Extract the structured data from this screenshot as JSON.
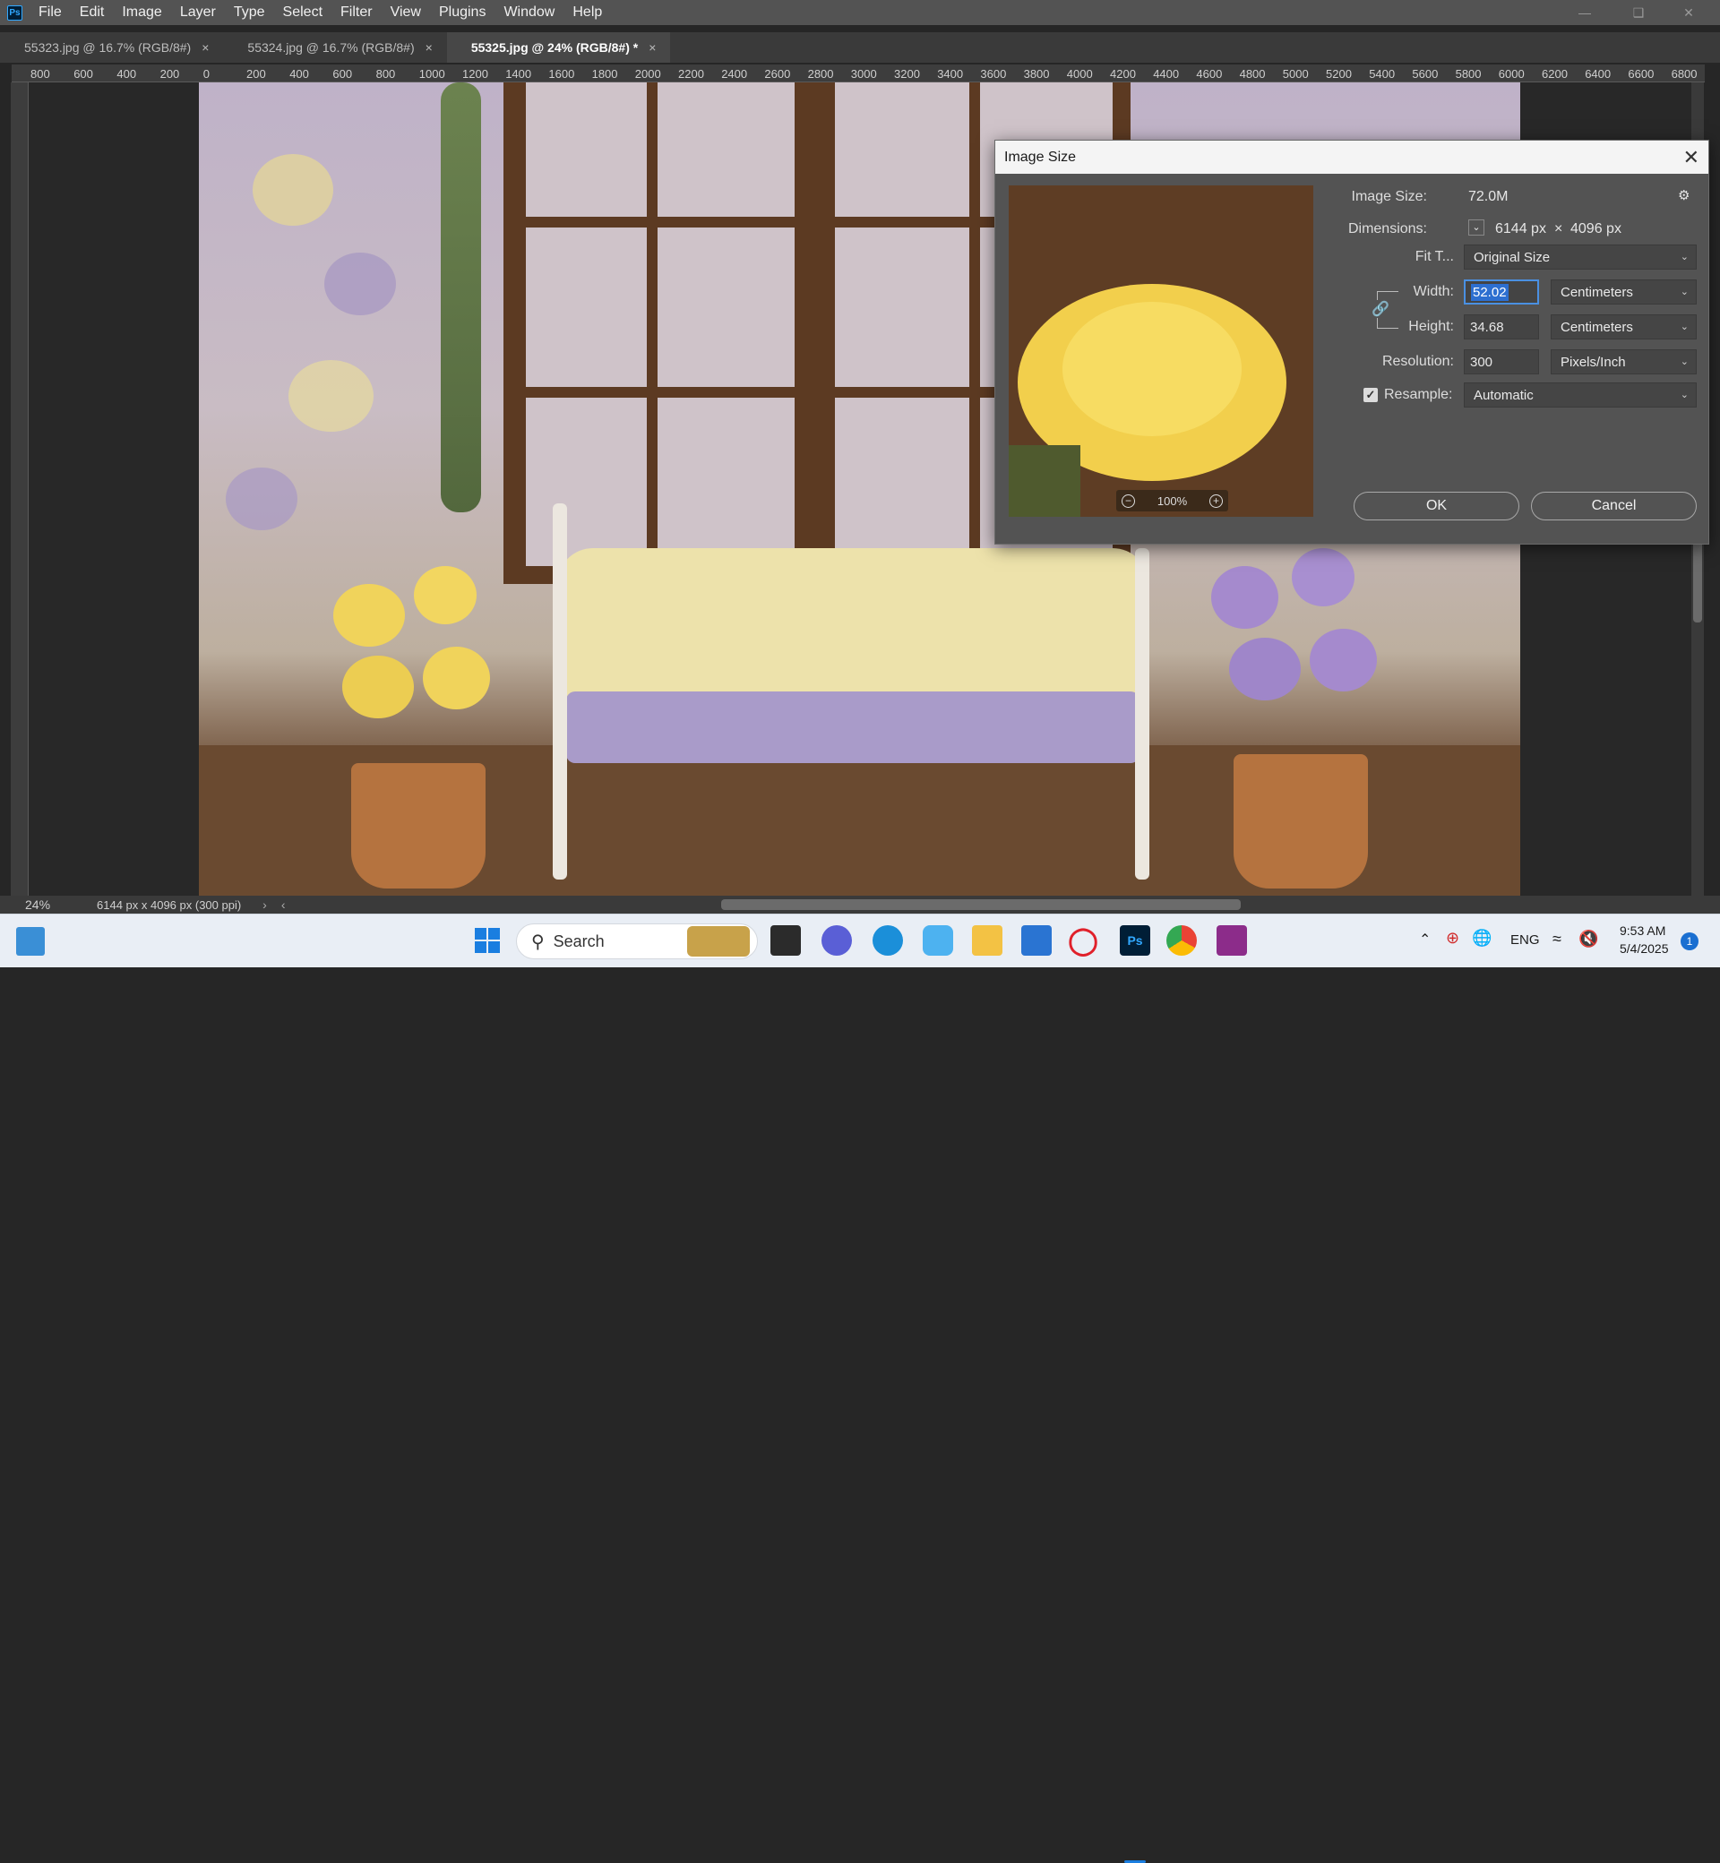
{
  "menubar": {
    "app_icon": "photoshop-icon",
    "items": [
      "File",
      "Edit",
      "Image",
      "Layer",
      "Type",
      "Select",
      "Filter",
      "View",
      "Plugins",
      "Window",
      "Help"
    ],
    "window_controls": [
      "minimize-icon",
      "restore-icon",
      "close-icon"
    ]
  },
  "tabs": [
    {
      "label": "55323.jpg @ 16.7% (RGB/8#)",
      "active": false
    },
    {
      "label": "55324.jpg @ 16.7% (RGB/8#)",
      "active": false
    },
    {
      "label": "55325.jpg @ 24% (RGB/8#) *",
      "active": true
    }
  ],
  "tab_close_glyph": "×",
  "ruler_top": [
    "800",
    "600",
    "400",
    "200",
    "0",
    "200",
    "400",
    "600",
    "800",
    "1000",
    "1200",
    "1400",
    "1600",
    "1800",
    "2000",
    "2200",
    "2400",
    "2600",
    "2800",
    "3000",
    "3200",
    "3400",
    "3600",
    "3800",
    "4000",
    "4200",
    "4400",
    "4600",
    "4800",
    "5000",
    "5200",
    "5400",
    "5600",
    "5800",
    "6000",
    "6200",
    "6400",
    "6600",
    "6800"
  ],
  "status": {
    "zoom": "24%",
    "doc_info": "6144 px x 4096 px (300 ppi)"
  },
  "dialog": {
    "title": "Image Size",
    "preview_zoom": "100%",
    "image_size_label": "Image Size:",
    "image_size_value": "72.0M",
    "dimensions_label": "Dimensions:",
    "dimensions_width": "6144 px",
    "dimensions_x": "×",
    "dimensions_height": "4096 px",
    "fit_to_label": "Fit T...",
    "fit_to_value": "Original Size",
    "width_label": "Width:",
    "width_value": "52.02",
    "width_unit": "Centimeters",
    "height_label": "Height:",
    "height_value": "34.68",
    "height_unit": "Centimeters",
    "resolution_label": "Resolution:",
    "resolution_value": "300",
    "resolution_unit": "Pixels/Inch",
    "resample_label": "Resample:",
    "resample_checked": true,
    "resample_value": "Automatic",
    "ok_label": "OK",
    "cancel_label": "Cancel"
  },
  "taskbar": {
    "search_placeholder": "Search",
    "language": "ENG",
    "time": "9:53 AM",
    "date": "5/4/2025",
    "notification_count": "1"
  }
}
